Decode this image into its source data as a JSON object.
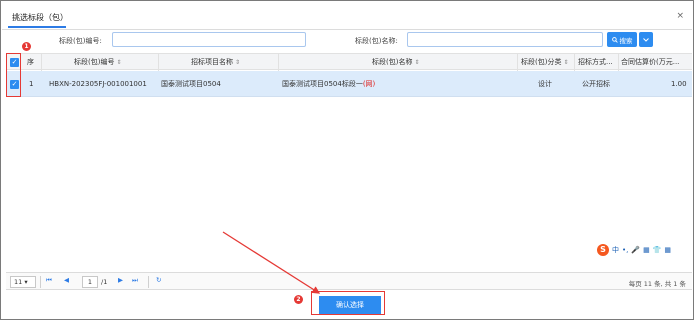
{
  "dialog": {
    "title": "挑选标段（包）",
    "close_glyph": "×"
  },
  "search": {
    "code_label": "标段(包)编号:",
    "code_value": "",
    "name_label": "标段(包)名称:",
    "name_value": "",
    "search_button": "搜索",
    "dropdown_glyph": "⌄"
  },
  "table": {
    "columns": [
      "序",
      "标段(包)编号",
      "招标项目名称",
      "标段(包)名称",
      "标段(包)分类",
      "招标方式...",
      "合同估算价(万元..."
    ],
    "sort_glyph": "⇕",
    "rows": [
      {
        "index": "1",
        "code": "HBXN-202305FJ-001001001",
        "project": "国泰测试项目0504",
        "name": "国泰测试项目0504标段一",
        "name_tag": "(网)",
        "category": "设计",
        "method": "公开招标",
        "price": "1.00",
        "checked": true
      }
    ]
  },
  "ime": {
    "logo": "S",
    "items": [
      "中",
      "•,",
      "🎤",
      "▦",
      "👕",
      "▦"
    ]
  },
  "pager": {
    "page_size": "11",
    "page_size_caret": "▾",
    "first": "⏮",
    "prev": "◀",
    "current_page": "1",
    "total_pages": "/1",
    "next": "▶",
    "last": "⏭",
    "refresh": "↻",
    "info": "每页 11 条, 共 1 条"
  },
  "confirm_button": "确认选择",
  "annotations": {
    "badge_1": "1",
    "badge_2": "2"
  },
  "colors": {
    "accent": "#2d8cf0",
    "selected_row": "#dcebfb",
    "annotation": "#e53935"
  }
}
